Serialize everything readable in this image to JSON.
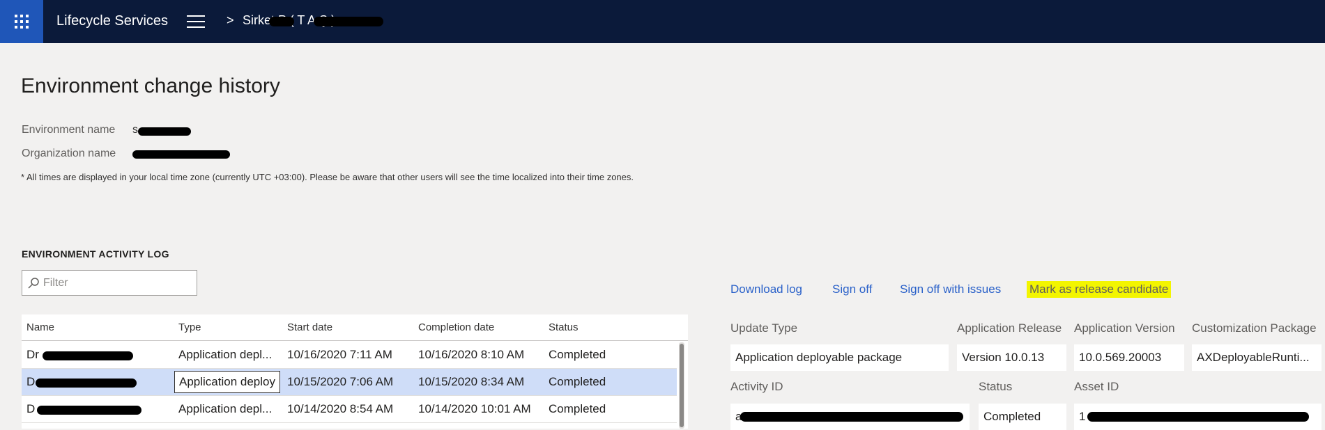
{
  "topbar": {
    "app_title": "Lifecycle Services",
    "breadcrumb_separator": ">",
    "project_name": "Sirket P (       T      A.Ş.)"
  },
  "page": {
    "title": "Environment change history",
    "environment_name_label": "Environment name",
    "environment_name_value": "s",
    "organization_name_label": "Organization name",
    "organization_name_value": "",
    "timezone_note": "* All times are displayed in your local time zone (currently UTC +03:00). Please be aware that other users will see the time localized into their time zones."
  },
  "activity_log": {
    "section_title": "ENVIRONMENT ACTIVITY LOG",
    "filter_placeholder": "Filter",
    "columns": [
      "Name",
      "Type",
      "Start date",
      "Completion date",
      "Status"
    ],
    "rows": [
      {
        "name": "Dr",
        "type": "Application depl...",
        "start": "10/16/2020 7:11 AM",
        "completion": "10/16/2020 8:10 AM",
        "status": "Completed"
      },
      {
        "name": "D",
        "type": "Application deploy",
        "start": "10/15/2020 7:06 AM",
        "completion": "10/15/2020 8:34 AM",
        "status": "Completed"
      },
      {
        "name": "D",
        "type": "Application depl...",
        "start": "10/14/2020 8:54 AM",
        "completion": "10/14/2020 10:01 AM",
        "status": "Completed"
      }
    ]
  },
  "actions": {
    "download_log": "Download log",
    "sign_off": "Sign off",
    "sign_off_with_issues": "Sign off with issues",
    "mark_release_candidate": "Mark as release candidate"
  },
  "details": {
    "update_type_label": "Update Type",
    "update_type_value": "Application deployable package",
    "app_release_label": "Application Release",
    "app_release_value": "Version 10.0.13",
    "app_version_label": "Application Version",
    "app_version_value": "10.0.569.20003",
    "customization_label": "Customization Package",
    "customization_value": "AXDeployableRunti...",
    "activity_id_label": "Activity ID",
    "activity_id_value": "a",
    "status_label": "Status",
    "status_value": "Completed",
    "asset_id_label": "Asset ID",
    "asset_id_value": "1"
  },
  "colors": {
    "topbar": "#0b1a3a",
    "waffle": "#1f56b8",
    "link": "#2a61c9",
    "highlight": "#f3f500",
    "selected_row": "#cfddf8"
  }
}
